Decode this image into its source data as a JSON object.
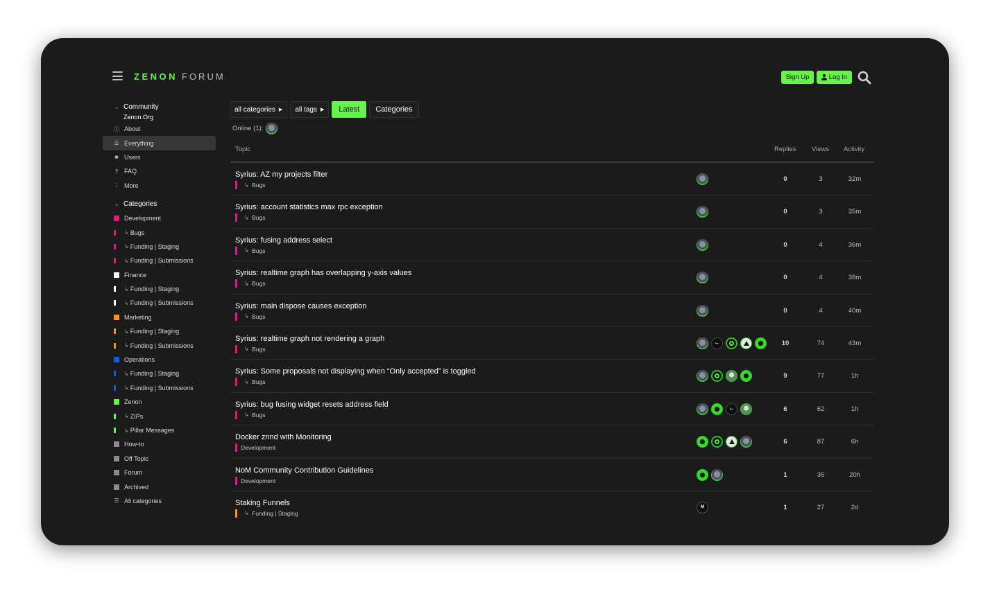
{
  "header": {
    "brand": "ZENON",
    "forum": "FORUM",
    "signup_label": "Sign Up",
    "login_label": "Log In"
  },
  "sidebar": {
    "community": {
      "heading": "Community",
      "subtitle": "Zenon.Org",
      "items": [
        {
          "label": "About",
          "icon": "info-icon"
        },
        {
          "label": "Everything",
          "icon": "layers-icon",
          "active": true
        },
        {
          "label": "Users",
          "icon": "users-icon"
        },
        {
          "label": "FAQ",
          "icon": "question-icon"
        },
        {
          "label": "More",
          "icon": "more-vertical-icon"
        }
      ]
    },
    "categories": {
      "heading": "Categories",
      "items": [
        {
          "label": "Development",
          "color": "#e5187e"
        },
        {
          "label": "Bugs",
          "color": "#e5187e"
        },
        {
          "label": "Funding | Staging",
          "color": "#e5187e"
        },
        {
          "label": "Funding | Submissions",
          "color": "#e5187e"
        },
        {
          "label": "Finance",
          "color": "#ffffff"
        },
        {
          "label": "Funding | Staging",
          "color": "#ffffff"
        },
        {
          "label": "Funding | Submissions",
          "color": "#ffffff"
        },
        {
          "label": "Marketing",
          "color": "#f7941d"
        },
        {
          "label": "Funding | Staging",
          "color": "#f7941d"
        },
        {
          "label": "Funding | Submissions",
          "color": "#f7941d"
        },
        {
          "label": "Operations",
          "color": "#0e5fe0"
        },
        {
          "label": "Funding | Staging",
          "color": "#0e5fe0"
        },
        {
          "label": "Funding | Submissions",
          "color": "#0e5fe0"
        },
        {
          "label": "Zenon",
          "color": "#66f34a"
        },
        {
          "label": "ZIPs",
          "color": "#66f34a"
        },
        {
          "label": "Pillar Messages",
          "color": "#66f34a"
        },
        {
          "label": "How-to",
          "color": "#8c8c8c"
        },
        {
          "label": "Off Topic",
          "color": "#8c8c8c"
        },
        {
          "label": "Forum",
          "color": "#8c8c8c"
        },
        {
          "label": "Archived",
          "color": "#8c8c8c"
        }
      ],
      "all_label": "All categories"
    }
  },
  "filters": {
    "categories": "all categories",
    "tags": "all tags",
    "latest": "Latest",
    "cats": "Categories"
  },
  "online_label": "Online (1):",
  "table": {
    "col_topic": "Topic",
    "col_replies": "Replies",
    "col_views": "Views",
    "col_activity": "Activity",
    "rows": [
      {
        "title": "Syrius: AZ my projects filter",
        "category": "Bugs",
        "sub": true,
        "cat_color": "#e5187e",
        "posters": [
          "a"
        ],
        "replies": "0",
        "views": "3",
        "activity": "32m"
      },
      {
        "title": "Syrius: account statistics max rpc exception",
        "category": "Bugs",
        "sub": true,
        "cat_color": "#e5187e",
        "posters": [
          "a"
        ],
        "replies": "0",
        "views": "3",
        "activity": "35m"
      },
      {
        "title": "Syrius: fusing address select",
        "category": "Bugs",
        "sub": true,
        "cat_color": "#e5187e",
        "posters": [
          "a"
        ],
        "replies": "0",
        "views": "4",
        "activity": "36m"
      },
      {
        "title": "Syrius: realtime graph has overlapping y-axis values",
        "category": "Bugs",
        "sub": true,
        "cat_color": "#e5187e",
        "posters": [
          "a"
        ],
        "replies": "0",
        "views": "4",
        "activity": "38m"
      },
      {
        "title": "Syrius: main dispose causes exception",
        "category": "Bugs",
        "sub": true,
        "cat_color": "#e5187e",
        "posters": [
          "a"
        ],
        "replies": "0",
        "views": "4",
        "activity": "40m"
      },
      {
        "title": "Syrius: realtime graph not rendering a graph",
        "category": "Bugs",
        "sub": true,
        "cat_color": "#e5187e",
        "posters": [
          "a",
          "b",
          "c",
          "d",
          "e"
        ],
        "replies": "10",
        "views": "74",
        "activity": "43m"
      },
      {
        "title": "Syrius: Some proposals not displaying when “Only accepted” is toggled",
        "category": "Bugs",
        "sub": true,
        "cat_color": "#e5187e",
        "posters": [
          "a",
          "c",
          "f",
          "e"
        ],
        "replies": "9",
        "views": "77",
        "activity": "1h"
      },
      {
        "title": "Syrius: bug fusing widget resets address field",
        "category": "Bugs",
        "sub": true,
        "cat_color": "#e5187e",
        "posters": [
          "a",
          "e",
          "b",
          "f"
        ],
        "replies": "6",
        "views": "62",
        "activity": "1h"
      },
      {
        "title": "Docker znnd with Monitoring",
        "category": "Development",
        "sub": false,
        "cat_color": "#e5187e",
        "posters": [
          "e",
          "c",
          "d",
          "a"
        ],
        "replies": "6",
        "views": "87",
        "activity": "6h"
      },
      {
        "title": "NoM Community Contribution Guidelines",
        "category": "Development",
        "sub": false,
        "cat_color": "#e5187e",
        "posters": [
          "e",
          "a"
        ],
        "replies": "1",
        "views": "35",
        "activity": "20h"
      },
      {
        "title": "Staking Funnels",
        "category": "Funding | Staging",
        "sub": true,
        "cat_color": "#f7941d",
        "posters": [
          "g"
        ],
        "replies": "1",
        "views": "27",
        "activity": "2d"
      }
    ]
  }
}
